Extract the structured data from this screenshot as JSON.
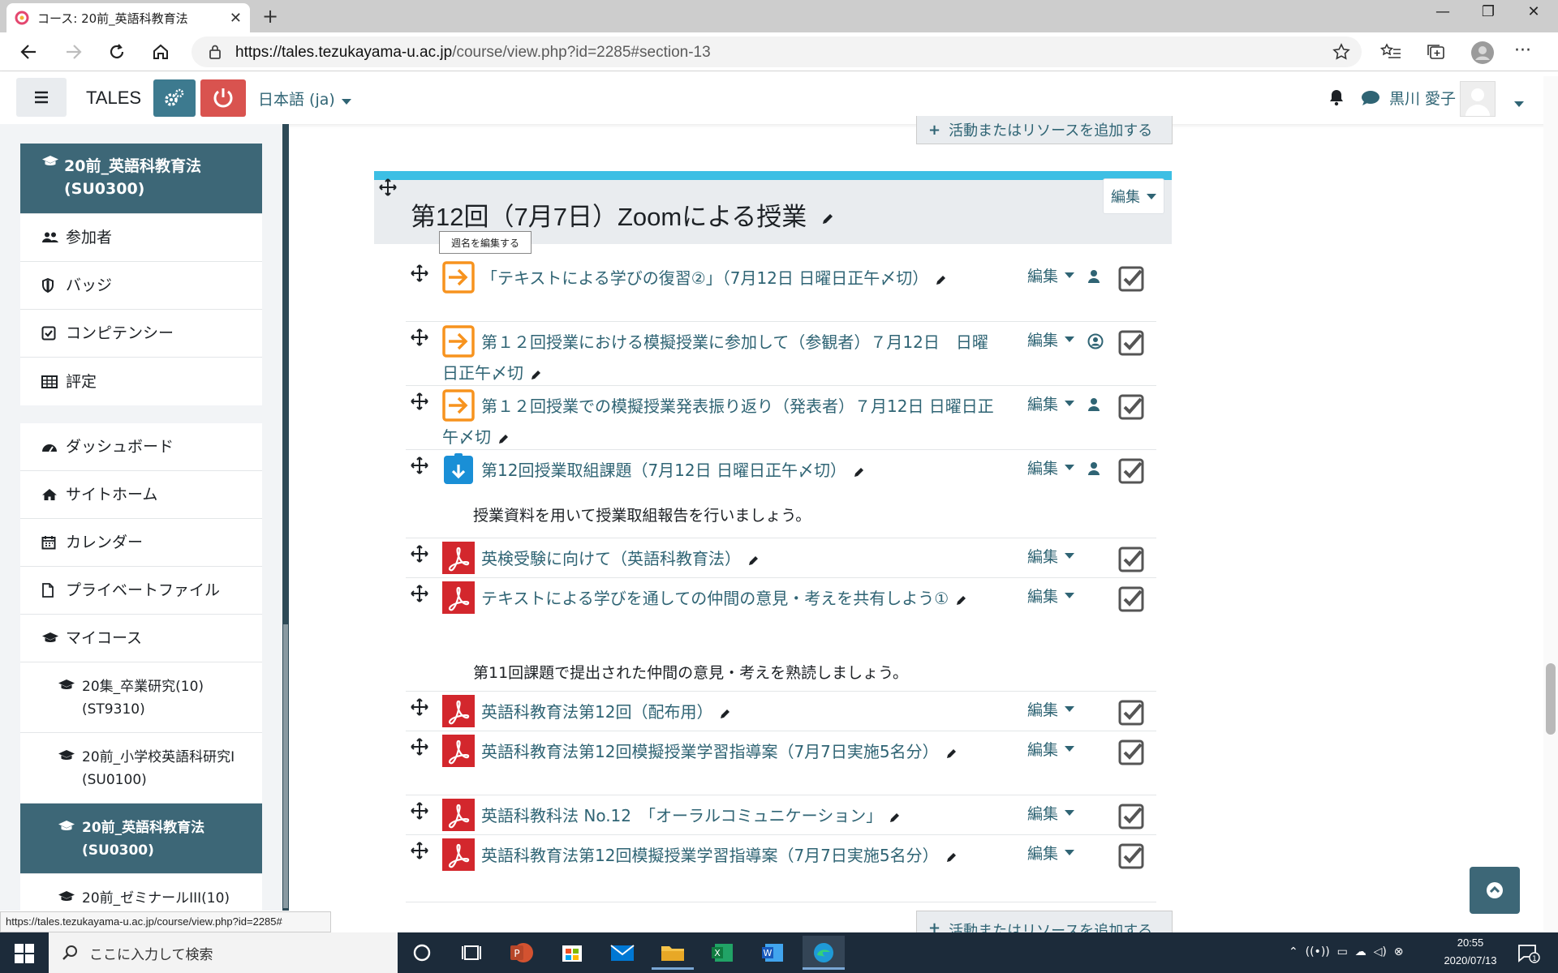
{
  "browser": {
    "tab_title": "コース: 20前_英語科教育法",
    "url_host": "https://tales.tezukayama-u.ac.jp",
    "url_path": "/course/view.php?id=2285#section-13",
    "status_url": "https://tales.tezukayama-u.ac.jp/course/view.php?id=2285#"
  },
  "navbar": {
    "brand": "TALES",
    "language": "日本語 (ja)",
    "user": "黒川 愛子"
  },
  "drawer": {
    "course_block": [
      {
        "label": "20前_英語科教育法 (SU0300)",
        "icon": "graduation-cap-icon",
        "selected": true
      },
      {
        "label": "参加者",
        "icon": "users-icon"
      },
      {
        "label": "バッジ",
        "icon": "shield-icon"
      },
      {
        "label": "コンピテンシー",
        "icon": "check-square-icon"
      },
      {
        "label": "評定",
        "icon": "table-icon"
      }
    ],
    "site_block": [
      {
        "label": "ダッシュボード",
        "icon": "dashboard-icon"
      },
      {
        "label": "サイトホーム",
        "icon": "home-icon"
      },
      {
        "label": "カレンダー",
        "icon": "calendar-icon"
      },
      {
        "label": "プライベートファイル",
        "icon": "file-icon"
      },
      {
        "label": "マイコース",
        "icon": "graduation-cap-icon"
      },
      {
        "label": "20集_卒業研究(10) (ST9310)",
        "icon": "graduation-cap-icon"
      },
      {
        "label": "20前_小学校英語科研究I(SU0100)",
        "icon": "graduation-cap-icon"
      },
      {
        "label": "20前_英語科教育法 (SU0300)",
        "icon": "graduation-cap-icon",
        "selected": true
      },
      {
        "label": "20前_ゼミナールIII(10)",
        "icon": "graduation-cap-icon"
      }
    ]
  },
  "section": {
    "add_resource": "活動またはリソースを追加する",
    "title": "第12回（7月7日）Zoomによる授業",
    "edit": "編集",
    "tooltip": "週名を編集する",
    "activities": [
      {
        "name": "「テキストによる学びの復習②」（7月12日 日曜日正午〆切）",
        "type": "assign",
        "group": "person",
        "edit": "編集"
      },
      {
        "name": "第１２回授業における模擬授業に参加して（参観者）７月12日　日曜日正午〆切",
        "type": "assign",
        "group": "person-circle",
        "edit": "編集"
      },
      {
        "name": "第１２回授業での模擬授業発表振り返り（発表者）７月12日 日曜日正午〆切",
        "type": "assign",
        "group": "person",
        "edit": "編集"
      },
      {
        "name": "第12回授業取組課題（7月12日 日曜日正午〆切）",
        "type": "folder",
        "group": "person",
        "edit": "編集",
        "description": "授業資料を用いて授業取組報告を行いましょう。"
      },
      {
        "name": "英検受験に向けて（英語科教育法）",
        "type": "pdf",
        "edit": "編集"
      },
      {
        "name": "テキストによる学びを通しての仲間の意見・考えを共有しよう①",
        "type": "pdf",
        "edit": "編集",
        "description": "第11回課題で提出された仲間の意見・考えを熟読しましょう。"
      },
      {
        "name": "英語科教育法第12回（配布用）",
        "type": "pdf",
        "edit": "編集"
      },
      {
        "name": "英語科教育法第12回模擬授業学習指導案（7月7日実施5名分）",
        "type": "pdf",
        "edit": "編集"
      },
      {
        "name": "英語科教科法 No.12　「オーラルコミュニケーション」",
        "type": "pdf",
        "edit": "編集"
      },
      {
        "name": "英語科教育法第12回模擬授業学習指導案（7月7日実施5名分）",
        "type": "pdf",
        "edit": "編集"
      }
    ]
  },
  "taskbar": {
    "search_placeholder": "ここに入力して検索",
    "time": "20:55",
    "date": "2020/07/13"
  },
  "colors": {
    "link": "#2f6474",
    "drawer_selected": "#3d6777",
    "section_accent": "#3dbfe4",
    "assign_icon": "#f7931e",
    "pdf_icon": "#d3272d",
    "folder_icon": "#1a8fd6"
  }
}
